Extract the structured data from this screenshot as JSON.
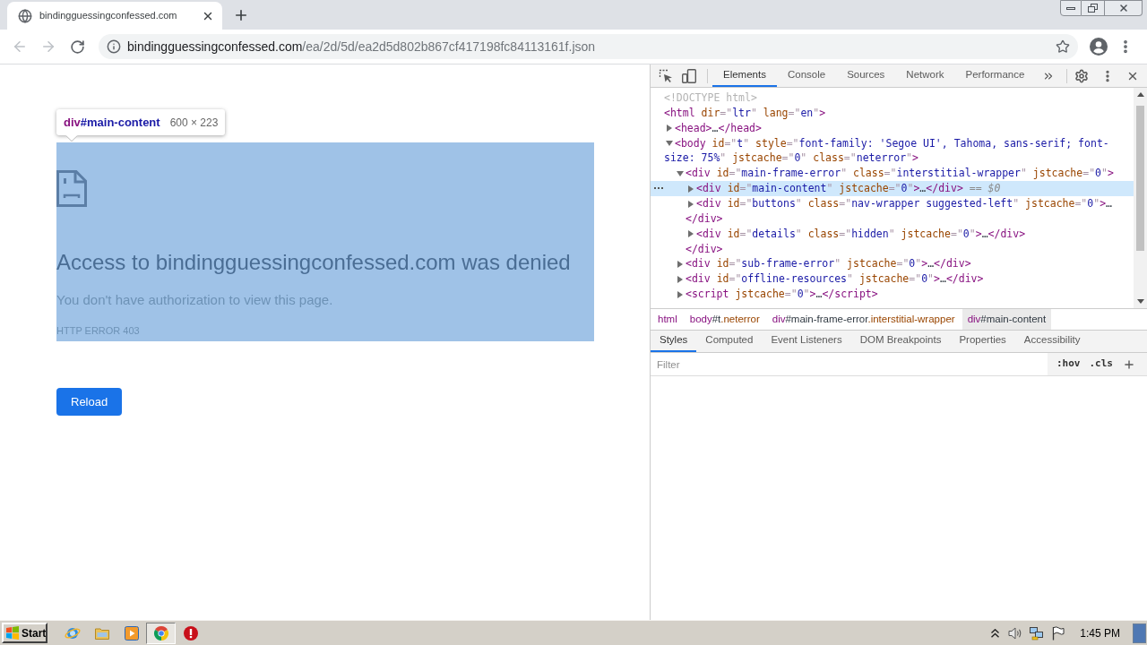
{
  "browser": {
    "tabs": [
      {
        "title": "bindingguessingconfessed.com",
        "selected": true
      }
    ],
    "nav_buttons": [
      {
        "kind": "back",
        "disabled": true
      },
      {
        "kind": "forward",
        "disabled": true
      },
      {
        "kind": "reload",
        "disabled": false
      }
    ],
    "address_bar": {
      "host": "bindingguessingconfessed.com",
      "path": "/ea/2d/5d/ea2d5d802b867cf417198fc84113161f.json"
    }
  },
  "page": {
    "inspect_tooltip": {
      "tag": "div",
      "id": "#main-content",
      "size": "600 × 223"
    },
    "error": {
      "title": "Access to bindingguessingconfessed.com was denied",
      "message": "You don't have authorization to view this page.",
      "code": "HTTP ERROR 403"
    },
    "reload_button": {
      "label": "Reload"
    }
  },
  "devtools": {
    "tabs": [
      {
        "label": "Elements",
        "selected": true
      },
      {
        "label": "Console",
        "selected": false
      },
      {
        "label": "Sources",
        "selected": false
      },
      {
        "label": "Network",
        "selected": false
      },
      {
        "label": "Performance",
        "selected": false
      }
    ],
    "dom_tree": [
      {
        "selected": false,
        "tokens": [
          {
            "kind": "doctype",
            "text": "<!DOCTYPE html>"
          }
        ]
      },
      {
        "selected": false,
        "tokens": [
          {
            "kind": "tag",
            "text": "<html"
          },
          {
            "kind": "attr",
            "text": " dir"
          },
          {
            "kind": "punct",
            "text": "=\""
          },
          {
            "kind": "value",
            "text": "ltr"
          },
          {
            "kind": "punct",
            "text": "\""
          },
          {
            "kind": "attr",
            "text": " lang"
          },
          {
            "kind": "punct",
            "text": "=\""
          },
          {
            "kind": "value",
            "text": "en"
          },
          {
            "kind": "punct",
            "text": "\""
          },
          {
            "kind": "tag",
            "text": ">"
          }
        ],
        "children": [
          {
            "selected": false,
            "expanded": false,
            "tokens": [
              {
                "kind": "tag",
                "text": "<head>"
              },
              {
                "kind": "ellipsis",
                "text": "…"
              },
              {
                "kind": "tag",
                "text": "</head>"
              }
            ]
          },
          {
            "selected": false,
            "expanded": true,
            "tokens": [
              {
                "kind": "tag",
                "text": "<body"
              },
              {
                "kind": "attr",
                "text": " id"
              },
              {
                "kind": "punct",
                "text": "=\""
              },
              {
                "kind": "value",
                "text": "t"
              },
              {
                "kind": "punct",
                "text": "\""
              },
              {
                "kind": "attr",
                "text": " style"
              },
              {
                "kind": "punct",
                "text": "=\""
              },
              {
                "kind": "value",
                "text": "font-family: 'Segoe UI', Tahoma, sans-serif; font-size: 75%"
              },
              {
                "kind": "punct",
                "text": "\""
              },
              {
                "kind": "attr",
                "text": " jstcache"
              },
              {
                "kind": "punct",
                "text": "=\""
              },
              {
                "kind": "value",
                "text": "0"
              },
              {
                "kind": "punct",
                "text": "\""
              },
              {
                "kind": "attr",
                "text": " class"
              },
              {
                "kind": "punct",
                "text": "=\""
              },
              {
                "kind": "value",
                "text": "neterror"
              },
              {
                "kind": "punct",
                "text": "\""
              },
              {
                "kind": "tag",
                "text": ">"
              }
            ],
            "children": [
              {
                "selected": false,
                "expanded": true,
                "tokens": [
                  {
                    "kind": "tag",
                    "text": "<div"
                  },
                  {
                    "kind": "attr",
                    "text": " id"
                  },
                  {
                    "kind": "punct",
                    "text": "=\""
                  },
                  {
                    "kind": "value",
                    "text": "main-frame-error"
                  },
                  {
                    "kind": "punct",
                    "text": "\""
                  },
                  {
                    "kind": "attr",
                    "text": " class"
                  },
                  {
                    "kind": "punct",
                    "text": "=\""
                  },
                  {
                    "kind": "value",
                    "text": "interstitial-wrapper"
                  },
                  {
                    "kind": "punct",
                    "text": "\""
                  },
                  {
                    "kind": "attr",
                    "text": " jstcache"
                  },
                  {
                    "kind": "punct",
                    "text": "=\""
                  },
                  {
                    "kind": "value",
                    "text": "0"
                  },
                  {
                    "kind": "punct",
                    "text": "\""
                  },
                  {
                    "kind": "tag",
                    "text": ">"
                  }
                ],
                "children": [
                  {
                    "selected": true,
                    "expanded": false,
                    "tokens": [
                      {
                        "kind": "tag",
                        "text": "<div"
                      },
                      {
                        "kind": "attr",
                        "text": " id"
                      },
                      {
                        "kind": "punct",
                        "text": "=\""
                      },
                      {
                        "kind": "value",
                        "text": "main-content"
                      },
                      {
                        "kind": "punct",
                        "text": "\""
                      },
                      {
                        "kind": "attr",
                        "text": " jstcache"
                      },
                      {
                        "kind": "punct",
                        "text": "=\""
                      },
                      {
                        "kind": "value",
                        "text": "0"
                      },
                      {
                        "kind": "punct",
                        "text": "\""
                      },
                      {
                        "kind": "tag",
                        "text": ">"
                      },
                      {
                        "kind": "ellipsis",
                        "text": "…"
                      },
                      {
                        "kind": "tag",
                        "text": "</div>"
                      },
                      {
                        "kind": "ref",
                        "text": " == $0"
                      }
                    ]
                  },
                  {
                    "selected": false,
                    "expanded": false,
                    "tokens": [
                      {
                        "kind": "tag",
                        "text": "<div"
                      },
                      {
                        "kind": "attr",
                        "text": " id"
                      },
                      {
                        "kind": "punct",
                        "text": "=\""
                      },
                      {
                        "kind": "value",
                        "text": "buttons"
                      },
                      {
                        "kind": "punct",
                        "text": "\""
                      },
                      {
                        "kind": "attr",
                        "text": " class"
                      },
                      {
                        "kind": "punct",
                        "text": "=\""
                      },
                      {
                        "kind": "value",
                        "text": "nav-wrapper suggested-left"
                      },
                      {
                        "kind": "punct",
                        "text": "\""
                      },
                      {
                        "kind": "attr",
                        "text": " jstcache"
                      },
                      {
                        "kind": "punct",
                        "text": "=\""
                      },
                      {
                        "kind": "value",
                        "text": "0"
                      },
                      {
                        "kind": "punct",
                        "text": "\""
                      },
                      {
                        "kind": "tag",
                        "text": ">"
                      },
                      {
                        "kind": "ellipsis",
                        "text": "…"
                      },
                      {
                        "kind": "tag",
                        "text": "</div>"
                      }
                    ]
                  },
                  {
                    "selected": false,
                    "expanded": false,
                    "tokens": [
                      {
                        "kind": "tag",
                        "text": "<div"
                      },
                      {
                        "kind": "attr",
                        "text": " id"
                      },
                      {
                        "kind": "punct",
                        "text": "=\""
                      },
                      {
                        "kind": "value",
                        "text": "details"
                      },
                      {
                        "kind": "punct",
                        "text": "\""
                      },
                      {
                        "kind": "attr",
                        "text": " class"
                      },
                      {
                        "kind": "punct",
                        "text": "=\""
                      },
                      {
                        "kind": "value",
                        "text": "hidden"
                      },
                      {
                        "kind": "punct",
                        "text": "\""
                      },
                      {
                        "kind": "attr",
                        "text": " jstcache"
                      },
                      {
                        "kind": "punct",
                        "text": "=\""
                      },
                      {
                        "kind": "value",
                        "text": "0"
                      },
                      {
                        "kind": "punct",
                        "text": "\""
                      },
                      {
                        "kind": "tag",
                        "text": ">"
                      },
                      {
                        "kind": "ellipsis",
                        "text": "…"
                      },
                      {
                        "kind": "tag",
                        "text": "</div>"
                      }
                    ]
                  }
                ],
                "closing": [
                  {
                    "kind": "tag",
                    "text": "</div>"
                  }
                ]
              },
              {
                "selected": false,
                "expanded": false,
                "tokens": [
                  {
                    "kind": "tag",
                    "text": "<div"
                  },
                  {
                    "kind": "attr",
                    "text": " id"
                  },
                  {
                    "kind": "punct",
                    "text": "=\""
                  },
                  {
                    "kind": "value",
                    "text": "sub-frame-error"
                  },
                  {
                    "kind": "punct",
                    "text": "\""
                  },
                  {
                    "kind": "attr",
                    "text": " jstcache"
                  },
                  {
                    "kind": "punct",
                    "text": "=\""
                  },
                  {
                    "kind": "value",
                    "text": "0"
                  },
                  {
                    "kind": "punct",
                    "text": "\""
                  },
                  {
                    "kind": "tag",
                    "text": ">"
                  },
                  {
                    "kind": "ellipsis",
                    "text": "…"
                  },
                  {
                    "kind": "tag",
                    "text": "</div>"
                  }
                ]
              },
              {
                "selected": false,
                "expanded": false,
                "tokens": [
                  {
                    "kind": "tag",
                    "text": "<div"
                  },
                  {
                    "kind": "attr",
                    "text": " id"
                  },
                  {
                    "kind": "punct",
                    "text": "=\""
                  },
                  {
                    "kind": "value",
                    "text": "offline-resources"
                  },
                  {
                    "kind": "punct",
                    "text": "\""
                  },
                  {
                    "kind": "attr",
                    "text": " jstcache"
                  },
                  {
                    "kind": "punct",
                    "text": "=\""
                  },
                  {
                    "kind": "value",
                    "text": "0"
                  },
                  {
                    "kind": "punct",
                    "text": "\""
                  },
                  {
                    "kind": "tag",
                    "text": ">"
                  },
                  {
                    "kind": "ellipsis",
                    "text": "…"
                  },
                  {
                    "kind": "tag",
                    "text": "</div>"
                  }
                ]
              },
              {
                "selected": false,
                "expanded": false,
                "tokens": [
                  {
                    "kind": "tag",
                    "text": "<script"
                  },
                  {
                    "kind": "attr",
                    "text": " jstcache"
                  },
                  {
                    "kind": "punct",
                    "text": "=\""
                  },
                  {
                    "kind": "value",
                    "text": "0"
                  },
                  {
                    "kind": "punct",
                    "text": "\""
                  },
                  {
                    "kind": "tag",
                    "text": ">"
                  },
                  {
                    "kind": "ellipsis",
                    "text": "…"
                  },
                  {
                    "kind": "tag",
                    "text": "</script>"
                  }
                ]
              }
            ]
          }
        ]
      }
    ],
    "breadcrumbs": [
      {
        "selected": false,
        "parts": [
          {
            "kind": "tag",
            "text": "html"
          }
        ]
      },
      {
        "selected": false,
        "parts": [
          {
            "kind": "tag",
            "text": "body"
          },
          {
            "kind": "id",
            "text": "#t"
          },
          {
            "kind": "class",
            "text": ".neterror"
          }
        ]
      },
      {
        "selected": false,
        "parts": [
          {
            "kind": "tag",
            "text": "div"
          },
          {
            "kind": "id",
            "text": "#main-frame-error"
          },
          {
            "kind": "class",
            "text": ".interstitial-wrapper"
          }
        ]
      },
      {
        "selected": true,
        "parts": [
          {
            "kind": "tag",
            "text": "div"
          },
          {
            "kind": "id",
            "text": "#main-content"
          }
        ]
      }
    ],
    "sidebar_tabs": [
      {
        "label": "Styles",
        "selected": true
      },
      {
        "label": "Computed",
        "selected": false
      },
      {
        "label": "Event Listeners",
        "selected": false
      },
      {
        "label": "DOM Breakpoints",
        "selected": false
      },
      {
        "label": "Properties",
        "selected": false
      },
      {
        "label": "Accessibility",
        "selected": false
      }
    ],
    "styles_toolbar": {
      "filter": {
        "placeholder": "Filter"
      },
      "buttons": [
        ":hov",
        ".cls"
      ]
    }
  },
  "taskbar": {
    "start": "Start",
    "apps": [
      {
        "kind": "internet-explorer",
        "selected": false
      },
      {
        "kind": "folder",
        "selected": false
      },
      {
        "kind": "media-player",
        "selected": false
      },
      {
        "kind": "chrome",
        "selected": true
      },
      {
        "kind": "alert",
        "selected": false
      }
    ],
    "clock": "1:45 PM"
  }
}
